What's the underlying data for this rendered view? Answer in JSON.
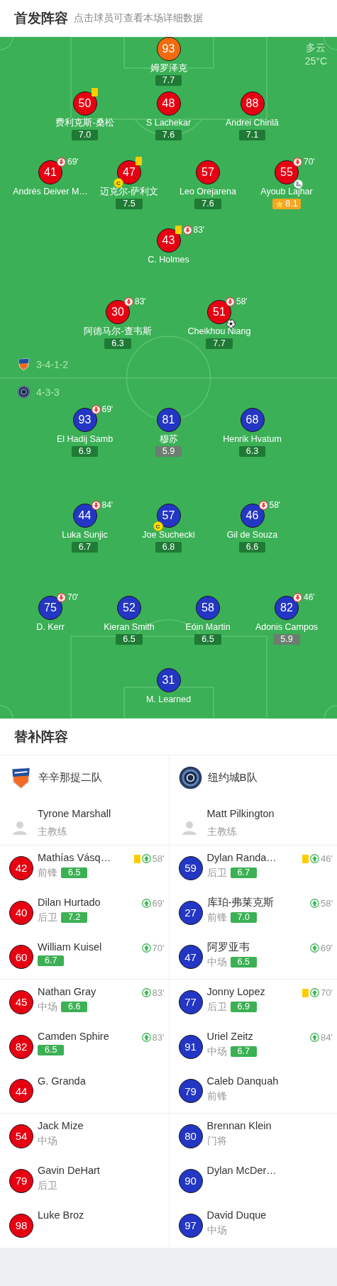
{
  "header": {
    "title": "首发阵容",
    "subtitle": "点击球员可查看本场详细数据"
  },
  "pitch": {
    "weather": {
      "condition": "多云",
      "temperature": "25°C"
    },
    "home": {
      "logo": {
        "kind": "shield"
      },
      "formation": "3-4-1-2",
      "lines": [
        [
          {
            "number": "93",
            "name": "姆罗泽克",
            "rating": {
              "value": "7.7",
              "kind": "normal"
            },
            "color": "#f26b0f",
            "yellow_card": false
          }
        ],
        [
          {
            "number": "50",
            "name": "费利克斯-桑松",
            "rating": {
              "value": "7.0",
              "kind": "normal"
            },
            "color": "#e60012",
            "yellow_card": true
          },
          {
            "number": "48",
            "name": "S Lachekar",
            "rating": {
              "value": "7.6",
              "kind": "normal"
            },
            "color": "#e60012",
            "yellow_card": false
          },
          {
            "number": "88",
            "name": "Andrei Chirilă",
            "rating": {
              "value": "7.1",
              "kind": "normal"
            },
            "color": "#e60012",
            "yellow_card": false
          }
        ],
        [
          {
            "number": "41",
            "name": "Andrés Deiver M…",
            "color": "#e60012",
            "yellow_card": false,
            "sub_off": "69'"
          },
          {
            "number": "47",
            "name": "迈克尔-萨利文",
            "rating": {
              "value": "7.5",
              "kind": "normal"
            },
            "color": "#e60012",
            "yellow_card": true,
            "captain": "C"
          },
          {
            "number": "57",
            "name": "Leo Orejarena",
            "rating": {
              "value": "7.6",
              "kind": "normal"
            },
            "color": "#e60012",
            "yellow_card": false
          },
          {
            "number": "55",
            "name": "Ayoub Lajhar",
            "rating": {
              "value": "8.1",
              "kind": "best"
            },
            "color": "#e60012",
            "yellow_card": false,
            "sub_off": "70'",
            "event": {
              "kind": "assist"
            }
          }
        ],
        [
          {
            "number": "43",
            "name": "C. Holmes",
            "color": "#e60012",
            "yellow_card": true,
            "sub_off": "83'"
          }
        ],
        [
          {
            "number": "30",
            "name": "阿德马尔-查韦斯",
            "rating": {
              "value": "6.3",
              "kind": "normal"
            },
            "color": "#e60012",
            "yellow_card": false,
            "sub_off": "83'"
          },
          {
            "number": "51",
            "name": "Cheikhou Niang",
            "rating": {
              "value": "7.7",
              "kind": "normal"
            },
            "color": "#e60012",
            "yellow_card": false,
            "sub_off": "58'",
            "event": {
              "kind": "goal"
            }
          }
        ]
      ]
    },
    "away": {
      "logo": {
        "kind": "round"
      },
      "formation": "4-3-3",
      "lines": [
        [
          {
            "number": "93",
            "name": "El Hadij Samb",
            "rating": {
              "value": "6.9",
              "kind": "normal"
            },
            "color": "#2336c4",
            "yellow_card": false,
            "sub_off": "69'"
          },
          {
            "number": "81",
            "name": "穆苏",
            "rating": {
              "value": "5.9",
              "kind": "low"
            },
            "color": "#2336c4",
            "yellow_card": false
          },
          {
            "number": "68",
            "name": "Henrik Hvatum",
            "rating": {
              "value": "6.3",
              "kind": "normal"
            },
            "color": "#2336c4",
            "yellow_card": false
          }
        ],
        [
          {
            "number": "44",
            "name": "Luka Sunjic",
            "rating": {
              "value": "6.7",
              "kind": "normal"
            },
            "color": "#2336c4",
            "yellow_card": false,
            "sub_off": "84'"
          },
          {
            "number": "57",
            "name": "Joe Suchecki",
            "rating": {
              "value": "6.8",
              "kind": "normal"
            },
            "color": "#2336c4",
            "yellow_card": false,
            "captain": "C"
          },
          {
            "number": "46",
            "name": "Gil de Souza",
            "rating": {
              "value": "6.6",
              "kind": "normal"
            },
            "color": "#2336c4",
            "yellow_card": false,
            "sub_off": "58'"
          }
        ],
        [
          {
            "number": "75",
            "name": "D. Kerr",
            "color": "#2336c4",
            "yellow_card": false,
            "sub_off": "70'"
          },
          {
            "number": "52",
            "name": "Kieran Smith",
            "rating": {
              "value": "6.5",
              "kind": "normal"
            },
            "color": "#2336c4",
            "yellow_card": false
          },
          {
            "number": "58",
            "name": "Eóin Martin",
            "rating": {
              "value": "6.5",
              "kind": "normal"
            },
            "color": "#2336c4",
            "yellow_card": false
          },
          {
            "number": "82",
            "name": "Adonis Campos",
            "rating": {
              "value": "5.9",
              "kind": "low"
            },
            "color": "#2336c4",
            "yellow_card": false,
            "sub_off": "46'"
          }
        ],
        [
          {
            "number": "31",
            "name": "M. Learned",
            "color": "#2336c4",
            "yellow_card": false
          }
        ]
      ]
    }
  },
  "subs": {
    "title": "替补阵容",
    "teams": [
      {
        "logo": {
          "kind": "shield"
        },
        "name": "辛辛那提二队",
        "color": "#e60012",
        "coach": {
          "name": "Tyrone Marshall",
          "role": "主教练"
        },
        "players": [
          {
            "number": "42",
            "name": "Mathías Vásq…",
            "position": "前锋",
            "rating": "6.5",
            "yellow_card": true,
            "sub_in": "58'"
          },
          {
            "number": "40",
            "name": "Dilan Hurtado",
            "position": "后卫",
            "rating": "7.2",
            "yellow_card": false,
            "sub_in": "69'"
          },
          {
            "number": "60",
            "name": "William Kuisel",
            "rating": "6.7",
            "yellow_card": false,
            "sub_in": "70'"
          },
          {
            "number": "45",
            "name": "Nathan Gray",
            "position": "中场",
            "rating": "6.6",
            "yellow_card": false,
            "sub_in": "83'"
          },
          {
            "number": "82",
            "name": "Camden Sphire",
            "rating": "6.5",
            "yellow_card": false,
            "sub_in": "83'"
          },
          {
            "number": "44",
            "name": "G. Granda",
            "yellow_card": false
          },
          {
            "number": "54",
            "name": "Jack Mize",
            "position": "中场",
            "yellow_card": false
          },
          {
            "number": "79",
            "name": "Gavin DeHart",
            "position": "后卫",
            "yellow_card": false
          },
          {
            "number": "98",
            "name": "Luke Broz",
            "yellow_card": false
          }
        ]
      },
      {
        "logo": {
          "kind": "round"
        },
        "name": "纽约城B队",
        "color": "#2336c4",
        "coach": {
          "name": "Matt Pilkington",
          "role": "主教练"
        },
        "players": [
          {
            "number": "59",
            "name": "Dylan Randa…",
            "position": "后卫",
            "rating": "6.7",
            "yellow_card": true,
            "sub_in": "46'"
          },
          {
            "number": "27",
            "name": "库珀-弗莱克斯",
            "position": "前锋",
            "rating": "7.0",
            "yellow_card": false,
            "sub_in": "58'"
          },
          {
            "number": "47",
            "name": "阿罗亚韦",
            "position": "中场",
            "rating": "6.5",
            "yellow_card": false,
            "sub_in": "69'"
          },
          {
            "number": "77",
            "name": "Jonny Lopez",
            "position": "后卫",
            "rating": "6.9",
            "yellow_card": true,
            "sub_in": "70'"
          },
          {
            "number": "91",
            "name": "Uriel Zeitz",
            "position": "中场",
            "rating": "6.7",
            "yellow_card": false,
            "sub_in": "84'"
          },
          {
            "number": "79",
            "name": "Caleb Danquah",
            "position": "前锋",
            "yellow_card": false
          },
          {
            "number": "80",
            "name": "Brennan Klein",
            "position": "门将",
            "yellow_card": false
          },
          {
            "number": "90",
            "name": "Dylan McDer…",
            "yellow_card": false
          },
          {
            "number": "97",
            "name": "David Duque",
            "position": "中场",
            "yellow_card": false
          }
        ]
      }
    ]
  }
}
